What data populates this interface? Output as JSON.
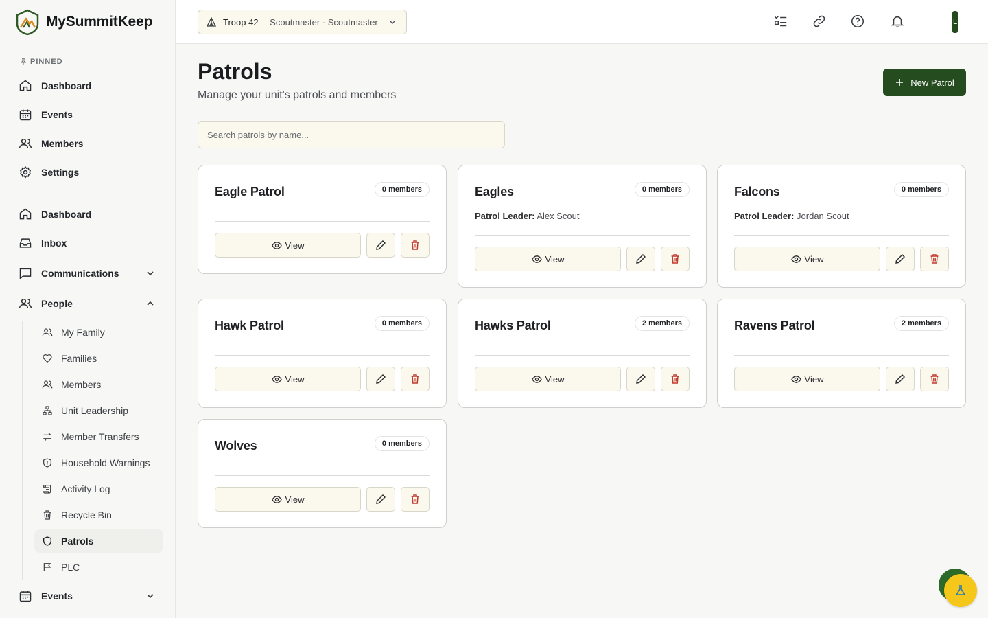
{
  "app": {
    "name": "MySummitKeep"
  },
  "sidebar": {
    "pinned_label": "PINNED",
    "pinned": [
      {
        "label": "Dashboard",
        "icon": "home-icon"
      },
      {
        "label": "Events",
        "icon": "calendar-icon"
      },
      {
        "label": "Members",
        "icon": "users-icon"
      },
      {
        "label": "Settings",
        "icon": "gear-icon"
      }
    ],
    "nav": [
      {
        "label": "Dashboard",
        "icon": "home-icon"
      },
      {
        "label": "Inbox",
        "icon": "inbox-icon"
      },
      {
        "label": "Communications",
        "icon": "message-square-icon",
        "expanded": false
      },
      {
        "label": "People",
        "icon": "users-icon",
        "expanded": true
      }
    ],
    "people_sub": [
      {
        "label": "My Family",
        "icon": "user-family-icon"
      },
      {
        "label": "Families",
        "icon": "heart-icon"
      },
      {
        "label": "Members",
        "icon": "users-icon"
      },
      {
        "label": "Unit Leadership",
        "icon": "org-chart-icon"
      },
      {
        "label": "Member Transfers",
        "icon": "transfer-arrows-icon"
      },
      {
        "label": "Household Warnings",
        "icon": "shield-alert-icon"
      },
      {
        "label": "Activity Log",
        "icon": "scroll-icon"
      },
      {
        "label": "Recycle Bin",
        "icon": "trash-icon"
      },
      {
        "label": "Patrols",
        "icon": "shield-icon",
        "active": true
      },
      {
        "label": "PLC",
        "icon": "flag-icon"
      }
    ],
    "events_section": {
      "label": "Events",
      "icon": "calendar-icon",
      "expanded": false
    }
  },
  "topbar": {
    "unit_select": {
      "troop": "Troop 42",
      "rest": " — Scoutmaster · Scoutmaster"
    },
    "icons": [
      "checklist-icon",
      "link-icon",
      "help-circle-icon",
      "bell-icon"
    ],
    "avatar_initial": "L"
  },
  "page": {
    "title": "Patrols",
    "subtitle": "Manage your unit's patrols and members",
    "new_button": "New Patrol",
    "search_placeholder": "Search patrols by name..."
  },
  "patrols": [
    {
      "name": "Eagle Patrol",
      "members": "0 members",
      "leader_label": "",
      "leader_name": ""
    },
    {
      "name": "Eagles",
      "members": "0 members",
      "leader_label": "Patrol Leader:",
      "leader_name": " Alex Scout"
    },
    {
      "name": "Falcons",
      "members": "0 members",
      "leader_label": "Patrol Leader:",
      "leader_name": " Jordan Scout"
    },
    {
      "name": "Hawk Patrol",
      "members": "0 members",
      "leader_label": "",
      "leader_name": ""
    },
    {
      "name": "Hawks Patrol",
      "members": "2 members",
      "leader_label": "",
      "leader_name": ""
    },
    {
      "name": "Ravens Patrol",
      "members": "2 members",
      "leader_label": "",
      "leader_name": ""
    },
    {
      "name": "Wolves",
      "members": "0 members",
      "leader_label": "",
      "leader_name": ""
    }
  ],
  "card_labels": {
    "view": "View"
  },
  "colors": {
    "primary": "#244c1e",
    "danger": "#c0392b",
    "input_bg": "#fbf8ee",
    "fab": "#f5c71a"
  }
}
